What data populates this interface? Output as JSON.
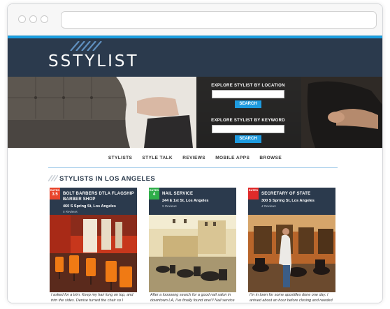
{
  "site": {
    "logo": "SSTYLIST",
    "search_location": {
      "label": "EXPLORE STYLIST BY LOCATION",
      "button": "SEARCH",
      "value": ""
    },
    "search_keyword": {
      "label": "EXPLORE STYLIST BY KEYWORD",
      "button": "SEARCH",
      "value": ""
    },
    "nav": [
      "STYLISTS",
      "STYLE TALK",
      "REVIEWS",
      "MOBILE APPS",
      "BROWSE"
    ],
    "section_title": "STYLISTS IN LOS ANGELES"
  },
  "cards": [
    {
      "badge_label": "RATED",
      "badge_value": "3.5",
      "badge_color": "#e8452c",
      "name": "BOLT BARBERS DTLA FLAGSHIP BARBER SHOP",
      "address": "460 S Spring St, Los Angeles",
      "reviews": "5 Reviews",
      "description": "I asked for a trim. Keep my hair long on top, and trim the sides. Denise turned the chair so I"
    },
    {
      "badge_label": "RATED",
      "badge_value": "4",
      "badge_color": "#2fae4a",
      "name": "NAIL SERVICE",
      "address": "244 E 1st St, Los Angeles",
      "reviews": "5 Reviews",
      "description": "After a looooong search for a good nail salon in downtown LA, I've finally found one!!! Nail service"
    },
    {
      "badge_label": "RATED",
      "badge_value": "",
      "badge_color": "#e02a2a",
      "name": "SECRETARY OF STATE",
      "address": "300 S Spring St, Los Angeles",
      "reviews": "4 Reviews",
      "description": "I'm in town for some apostilles done one day. I arrived about an hour before closing and needed about"
    }
  ],
  "colors": {
    "header_bg": "#2b3a4d",
    "accent_blue": "#1a9ee0"
  }
}
